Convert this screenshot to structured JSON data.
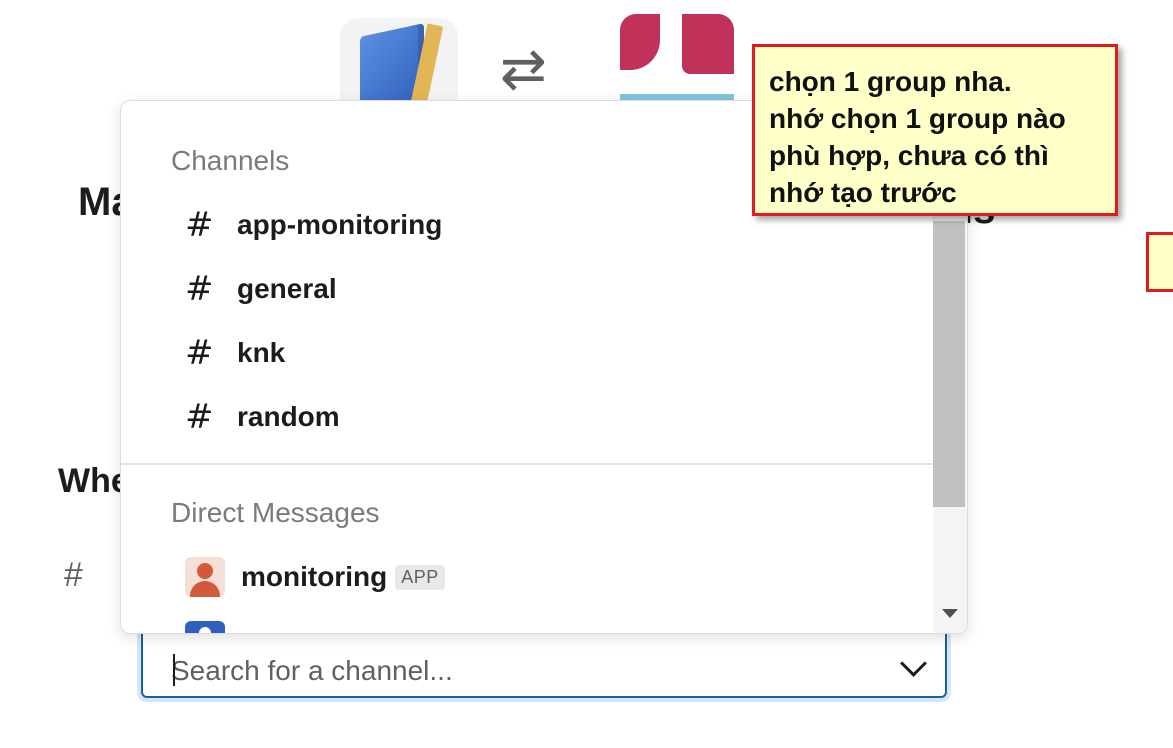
{
  "background": {
    "title_left": "Ma",
    "title_right": "ls",
    "section_label": "Whe",
    "hash_glyph": "#",
    "arrows_glyph": "⇄"
  },
  "dropdown": {
    "channels_header": "Channels",
    "channels": [
      {
        "glyph": "#",
        "name": "app-monitoring"
      },
      {
        "glyph": "#",
        "name": "general"
      },
      {
        "glyph": "#",
        "name": "knk"
      },
      {
        "glyph": "#",
        "name": "random"
      }
    ],
    "dm_header": "Direct Messages",
    "direct_messages": [
      {
        "name": "monitoring",
        "badge": "APP",
        "avatar_icon": "person-icon"
      }
    ]
  },
  "search": {
    "placeholder": "Search for a channel...",
    "value": ""
  },
  "annotation": {
    "text": "chọn 1 group nha.\nnhớ chọn 1 group nào phù hợp, chưa có thì nhớ tạo trước",
    "border_color": "#e11b1b",
    "fill_color": "#ffffc8"
  },
  "colors": {
    "focus_border": "#1264a3",
    "text": "#1d1c1d",
    "muted": "#7a7a7a"
  }
}
